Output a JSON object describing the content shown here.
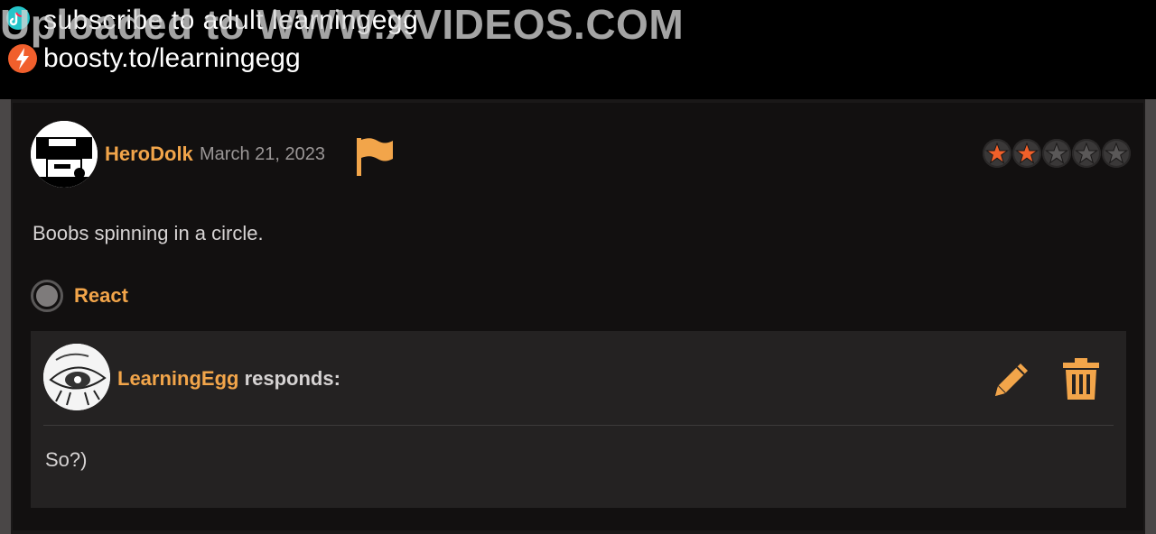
{
  "overlay": {
    "line1": "subscribe to adult learningegg",
    "watermark": "Uploaded to WWW.XVIDEOS.COM",
    "line2": "boosty.to/learningegg",
    "icons": [
      "tiktok-icon",
      "boosty-bolt-icon"
    ]
  },
  "comment": {
    "username": "HeroDolk",
    "date": "March 21, 2023",
    "text": "Boobs spinning in a circle.",
    "rating": {
      "value": 2,
      "max": 5
    },
    "react_label": "React",
    "icons": [
      "report-flag-icon",
      "star-icon"
    ]
  },
  "response": {
    "username": "LearningEgg",
    "suffix": "responds:",
    "text": "So?)",
    "icons": [
      "edit-pencil-icon",
      "trash-icon"
    ]
  },
  "colors": {
    "accent": "#f2a54a",
    "panel_bg": "#121010",
    "response_bg": "#242222",
    "star_filled": "#f0602a",
    "text": "#d6d3d3",
    "muted": "#9a9696"
  }
}
